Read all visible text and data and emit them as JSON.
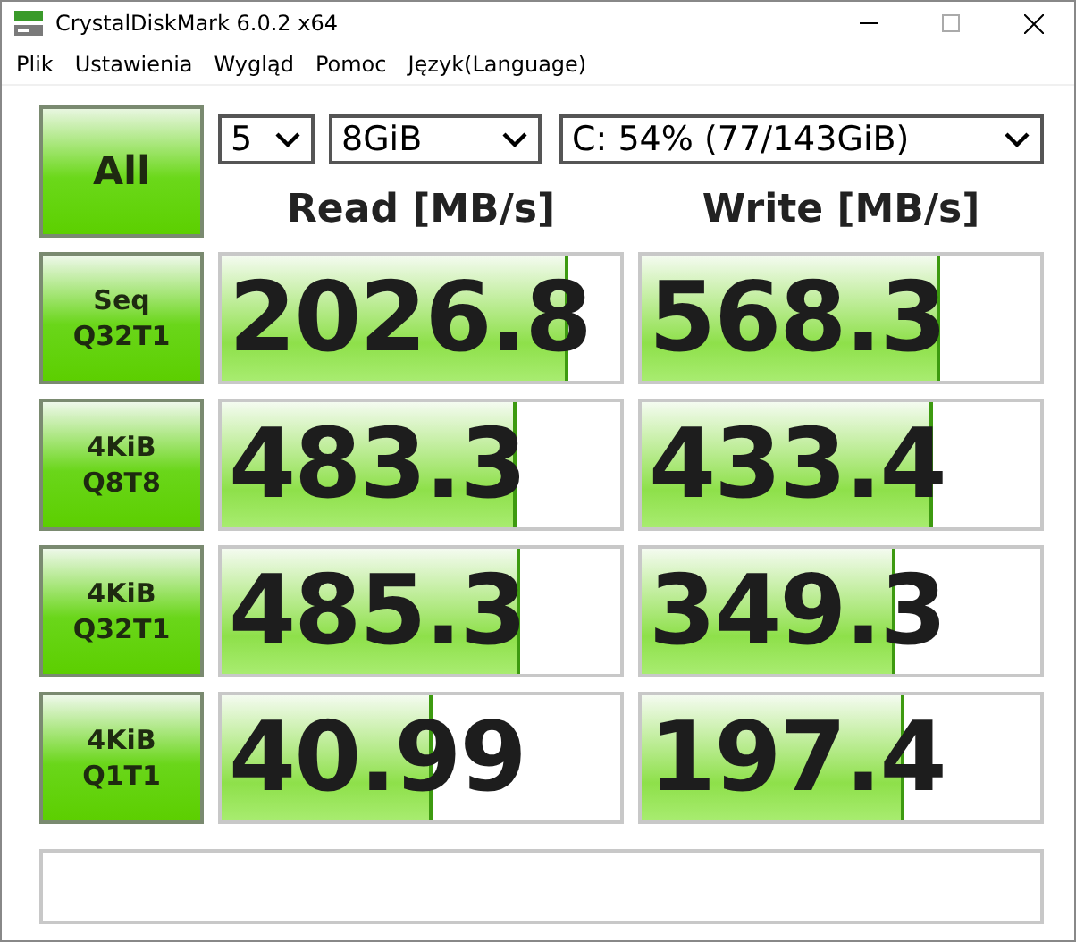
{
  "window": {
    "title": "CrystalDiskMark 6.0.2 x64"
  },
  "menu": [
    "Plik",
    "Ustawienia",
    "Wygląd",
    "Pomoc",
    "Język(Language)"
  ],
  "all_button": "All",
  "selects": [
    {
      "value": "5"
    },
    {
      "value": "8GiB"
    },
    {
      "value": "C: 54% (77/143GiB)"
    }
  ],
  "headers": [
    "Read [MB/s]",
    "Write [MB/s]"
  ],
  "rows": [
    {
      "label": [
        "Seq",
        "Q32T1"
      ],
      "read": {
        "value": "2026.8",
        "level": 0.86
      },
      "write": {
        "value": "568.3",
        "level": 0.74
      }
    },
    {
      "label": [
        "4KiB",
        "Q8T8"
      ],
      "read": {
        "value": "483.3",
        "level": 0.73
      },
      "write": {
        "value": "433.4",
        "level": 0.72
      }
    },
    {
      "label": [
        "4KiB",
        "Q32T1"
      ],
      "read": {
        "value": "485.3",
        "level": 0.74
      },
      "write": {
        "value": "349.3",
        "level": 0.63
      }
    },
    {
      "label": [
        "4KiB",
        "Q1T1"
      ],
      "read": {
        "value": "40.99",
        "level": 0.52
      },
      "write": {
        "value": "197.4",
        "level": 0.65
      }
    }
  ]
}
